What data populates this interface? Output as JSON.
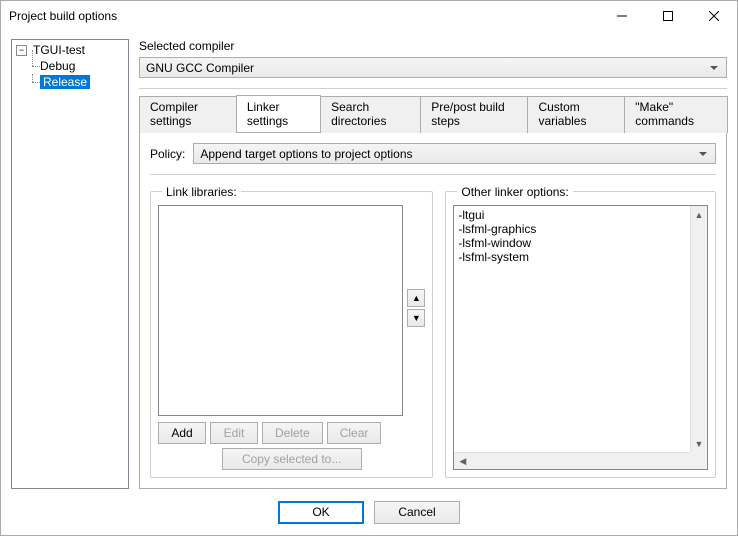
{
  "window": {
    "title": "Project build options"
  },
  "tree": {
    "root": "TGUI-test",
    "children": [
      "Debug",
      "Release"
    ],
    "selected": "Release"
  },
  "compiler": {
    "group_label": "Selected compiler",
    "selected": "GNU GCC Compiler"
  },
  "tabs": {
    "items": [
      "Compiler settings",
      "Linker settings",
      "Search directories",
      "Pre/post build steps",
      "Custom variables",
      "\"Make\" commands"
    ],
    "active": "Linker settings"
  },
  "policy": {
    "label": "Policy:",
    "selected": "Append target options to project options"
  },
  "link_libraries": {
    "title": "Link libraries:",
    "items": [],
    "buttons": {
      "add": "Add",
      "edit": "Edit",
      "delete": "Delete",
      "clear": "Clear"
    },
    "copy_btn": "Copy selected to..."
  },
  "other_options": {
    "title": "Other linker options:",
    "text": "-ltgui\n-lsfml-graphics\n-lsfml-window\n-lsfml-system"
  },
  "footer": {
    "ok": "OK",
    "cancel": "Cancel"
  }
}
